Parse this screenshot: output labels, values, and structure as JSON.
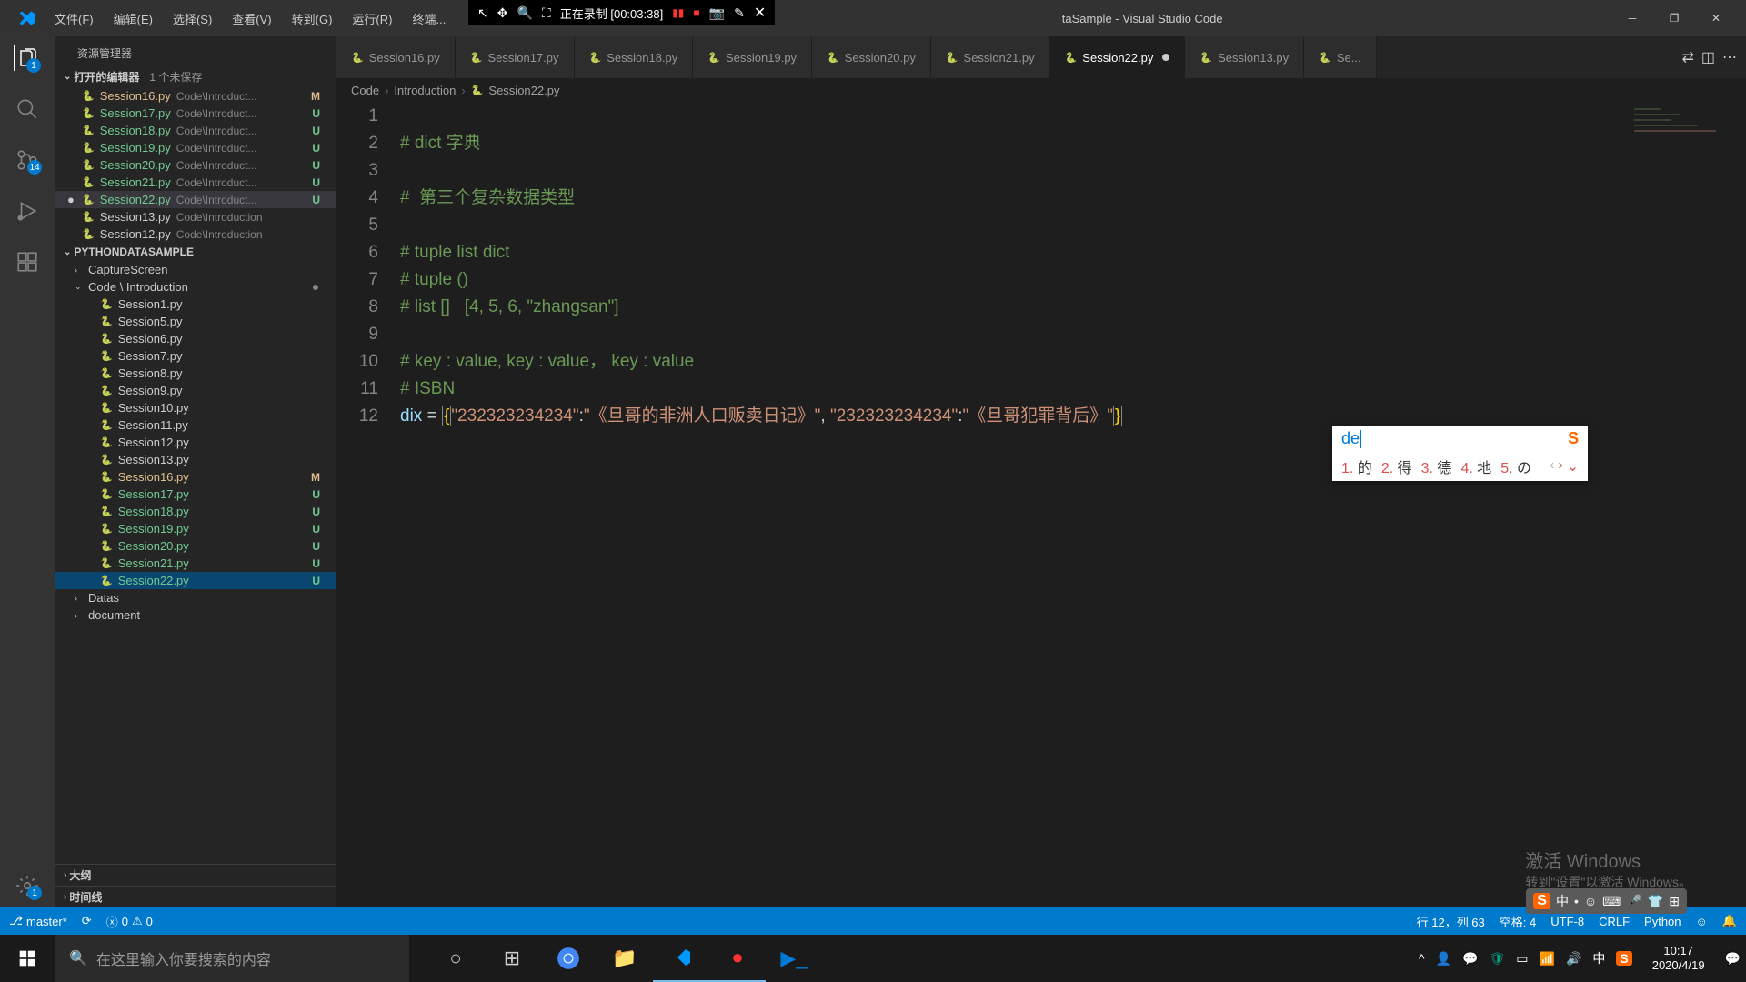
{
  "recording": {
    "status": "正在录制",
    "time": "[00:03:38]"
  },
  "menu": [
    "文件(F)",
    "编辑(E)",
    "选择(S)",
    "查看(V)",
    "转到(G)",
    "运行(R)",
    "终端..."
  ],
  "title_suffix": "taSample - Visual Studio Code",
  "activity": {
    "scm_badge": "14",
    "settings_badge": "1",
    "explorer_badge": "1"
  },
  "sidebar": {
    "title": "资源管理器",
    "open_editors_label": "打开的编辑器",
    "unsaved": "1 个未保存",
    "open_editors": [
      {
        "name": "Session16.py",
        "path": "Code\\Introduct...",
        "status": "M"
      },
      {
        "name": "Session17.py",
        "path": "Code\\Introduct...",
        "status": "U"
      },
      {
        "name": "Session18.py",
        "path": "Code\\Introduct...",
        "status": "U"
      },
      {
        "name": "Session19.py",
        "path": "Code\\Introduct...",
        "status": "U"
      },
      {
        "name": "Session20.py",
        "path": "Code\\Introduct...",
        "status": "U"
      },
      {
        "name": "Session21.py",
        "path": "Code\\Introduct...",
        "status": "U"
      },
      {
        "name": "Session22.py",
        "path": "Code\\Introduct...",
        "status": "U",
        "dirty": true,
        "active": true
      },
      {
        "name": "Session13.py",
        "path": "Code\\Introduction",
        "status": ""
      },
      {
        "name": "Session12.py",
        "path": "Code\\Introduction",
        "status": ""
      }
    ],
    "workspace": "PYTHONDATASAMPLE",
    "folders": [
      {
        "name": "CaptureScreen",
        "expanded": false
      },
      {
        "name": "Code \\ Introduction",
        "expanded": true,
        "dot": true
      }
    ],
    "files": [
      {
        "name": "Session1.py",
        "status": ""
      },
      {
        "name": "Session5.py",
        "status": ""
      },
      {
        "name": "Session6.py",
        "status": ""
      },
      {
        "name": "Session7.py",
        "status": ""
      },
      {
        "name": "Session8.py",
        "status": ""
      },
      {
        "name": "Session9.py",
        "status": ""
      },
      {
        "name": "Session10.py",
        "status": ""
      },
      {
        "name": "Session11.py",
        "status": ""
      },
      {
        "name": "Session12.py",
        "status": ""
      },
      {
        "name": "Session13.py",
        "status": ""
      },
      {
        "name": "Session16.py",
        "status": "M"
      },
      {
        "name": "Session17.py",
        "status": "U"
      },
      {
        "name": "Session18.py",
        "status": "U"
      },
      {
        "name": "Session19.py",
        "status": "U"
      },
      {
        "name": "Session20.py",
        "status": "U"
      },
      {
        "name": "Session21.py",
        "status": "U"
      },
      {
        "name": "Session22.py",
        "status": "U",
        "selected": true
      }
    ],
    "folders_after": [
      {
        "name": "Datas"
      },
      {
        "name": "document"
      }
    ],
    "outline": "大纲",
    "timeline": "时间线"
  },
  "tabs": [
    {
      "name": "Session16.py"
    },
    {
      "name": "Session17.py"
    },
    {
      "name": "Session18.py"
    },
    {
      "name": "Session19.py"
    },
    {
      "name": "Session20.py"
    },
    {
      "name": "Session21.py"
    },
    {
      "name": "Session22.py",
      "active": true,
      "dirty": true
    },
    {
      "name": "Session13.py"
    },
    {
      "name": "Se..."
    }
  ],
  "breadcrumb": [
    "Code",
    "Introduction",
    "Session22.py"
  ],
  "code": {
    "lines": [
      {
        "n": 1,
        "t": ""
      },
      {
        "n": 2,
        "t": "# dict 字典",
        "c": "cmt"
      },
      {
        "n": 3,
        "t": ""
      },
      {
        "n": 4,
        "t": "#  第三个复杂数据类型",
        "c": "cmt"
      },
      {
        "n": 5,
        "t": ""
      },
      {
        "n": 6,
        "t": "# tuple list dict",
        "c": "cmt"
      },
      {
        "n": 7,
        "t": "# tuple ()",
        "c": "cmt"
      },
      {
        "n": 8,
        "t": "# list []   [4, 5, 6, \"zhangsan\"]",
        "c": "cmt"
      },
      {
        "n": 9,
        "t": ""
      },
      {
        "n": 10,
        "t": "# key : value, key : value， key : value",
        "c": "cmt"
      },
      {
        "n": 11,
        "t": "# ISBN",
        "c": "cmt"
      }
    ],
    "line12": {
      "var": "dix",
      "eq": " = ",
      "k1": "\"232323234234\"",
      "v1": "\"《旦哥的非洲人口贩卖日记》\"",
      "k2": "\"232323234234\"",
      "v2": "\"《旦哥犯罪背后》\""
    }
  },
  "ime": {
    "input": "de",
    "candidates": [
      {
        "n": "1.",
        "t": "的"
      },
      {
        "n": "2.",
        "t": "得"
      },
      {
        "n": "3.",
        "t": "德"
      },
      {
        "n": "4.",
        "t": "地"
      },
      {
        "n": "5.",
        "t": "の"
      }
    ]
  },
  "watermark": {
    "l1": "激活 Windows",
    "l2": "转到\"设置\"以激活 Windows。"
  },
  "statusbar": {
    "branch": "master*",
    "errors": "0",
    "warnings": "0",
    "pos": "行 12，列 63",
    "spaces": "空格: 4",
    "enc": "UTF-8",
    "eol": "CRLF",
    "lang": "Python"
  },
  "taskbar": {
    "search": "在这里输入你要搜索的内容",
    "time": "10:17",
    "date": "2020/4/19",
    "ime_ch": "中"
  }
}
